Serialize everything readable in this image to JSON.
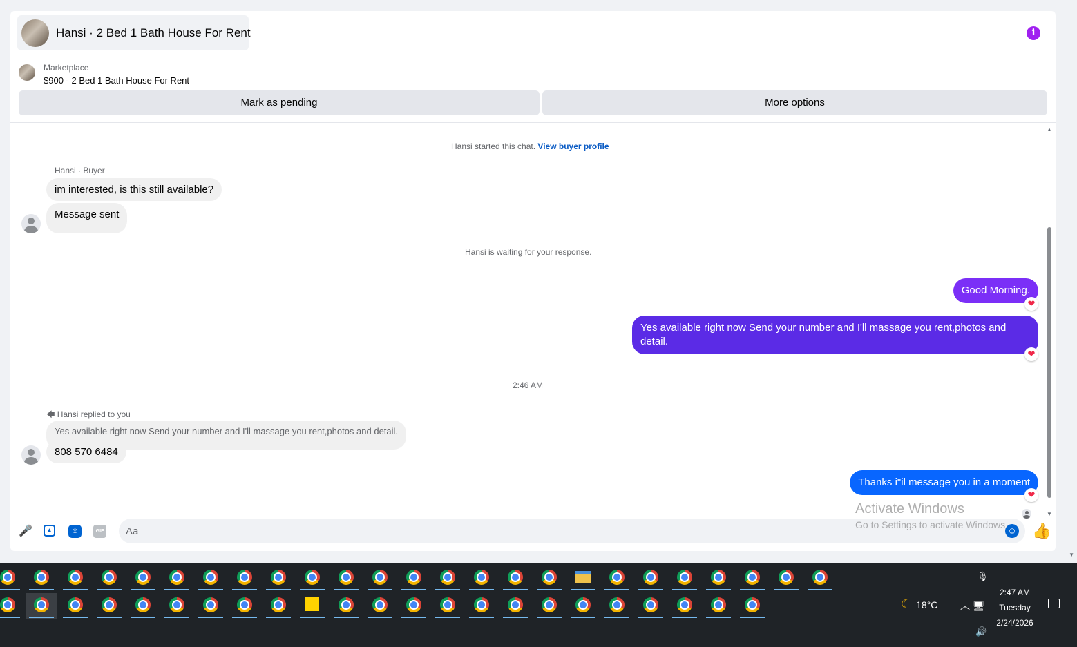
{
  "header": {
    "title": "Hansi · 2 Bed 1 Bath House For Rent"
  },
  "listing": {
    "category": "Marketplace",
    "price_title": "$900 - 2 Bed 1 Bath House For Rent",
    "btn_pending": "Mark as pending",
    "btn_more": "More options"
  },
  "chat": {
    "started_text": "Hansi started this chat.",
    "view_profile": "View buyer profile",
    "sender_label": "Hansi · Buyer",
    "msg_interested": "im interested, is this still available?",
    "msg_sent": "Message sent",
    "waiting": "Hansi is waiting for your response.",
    "out_morning": "Good Morning.",
    "out_available": "Yes available right now Send your number and I'll massage you rent,photos and detail.",
    "timestamp": "2:46 AM",
    "replied_label": "Hansi replied to you",
    "reply_quote": "Yes available right now Send your number and I'll massage you rent,photos and detail.",
    "msg_number": "808 570 6484",
    "out_thanks": "Thanks i\"il message you in a moment",
    "reaction": "❤",
    "colors": {
      "out_purple_1": "#7b2ff7",
      "out_purple_2": "#5b2be6",
      "out_blue": "#0866ff"
    }
  },
  "composer": {
    "placeholder": "Aa"
  },
  "watermark": {
    "title": "Activate Windows",
    "subtitle": "Go to Settings to activate Windows."
  },
  "taskbar": {
    "weather": "18°C",
    "time": "2:47 AM",
    "day": "Tuesday",
    "date": "2/24/2026"
  }
}
